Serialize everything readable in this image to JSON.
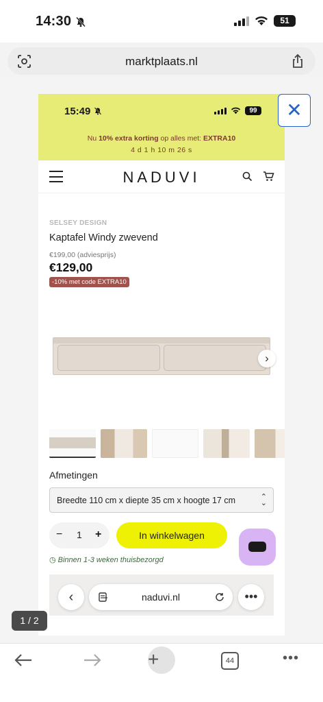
{
  "status_bar": {
    "time": "14:30",
    "battery": "51"
  },
  "url_bar": {
    "domain": "marktplaats.nl"
  },
  "inner_shot": {
    "status": {
      "time": "15:49",
      "battery": "99"
    },
    "promo": {
      "prefix": "Nu ",
      "bold1": "10% extra korting",
      "mid": " op alles met: ",
      "code": "EXTRA10",
      "countdown": "4 d 1 h 10 m 26 s"
    },
    "nav": {
      "logo": "NADUVI"
    },
    "product": {
      "brand": "SELSEY DESIGN",
      "title": "Kaptafel Windy zwevend",
      "old_price": "€199,00 (adviesprijs)",
      "price": "€129,00",
      "badge": "-10% met code EXTRA10",
      "dimensions_label": "Afmetingen",
      "dimensions_value": "Breedte 110 cm x diepte 35 cm x hoogte 17 cm",
      "qty_minus": "−",
      "qty_value": "1",
      "qty_plus": "+",
      "add_to_cart": "In winkelwagen",
      "delivery": "Binnen 1-3 weken thuisbezorgd"
    },
    "inner_toolbar": {
      "domain": "naduvi.nl"
    }
  },
  "pager": {
    "label": "1 / 2"
  },
  "toolbar": {
    "tabs_count": "44"
  }
}
